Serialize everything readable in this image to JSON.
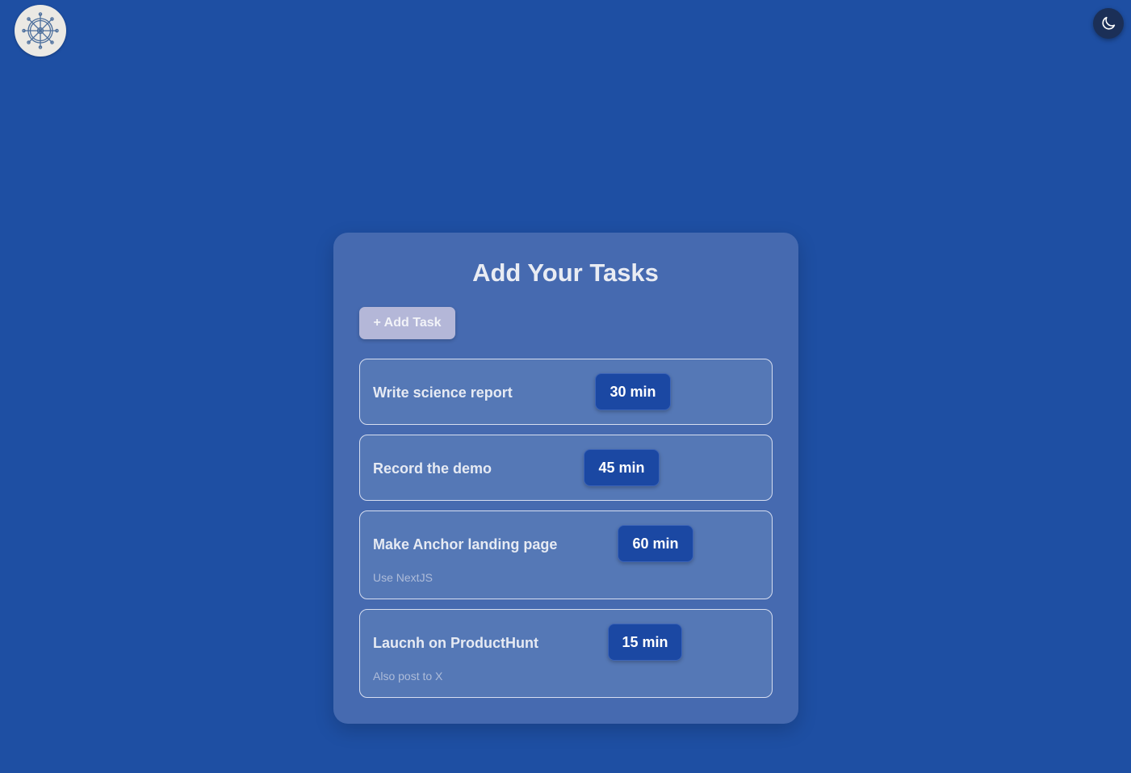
{
  "header": {
    "logo_icon": "ship-wheel-icon",
    "theme_toggle_icon": "moon-icon"
  },
  "main": {
    "title": "Add Your Tasks",
    "add_task_label": "+ Add Task",
    "tasks": [
      {
        "name": "Write science report",
        "duration": "30 min",
        "note": ""
      },
      {
        "name": "Record the demo",
        "duration": "45 min",
        "note": ""
      },
      {
        "name": "Make Anchor landing page",
        "duration": "60 min",
        "note": "Use NextJS"
      },
      {
        "name": "Laucnh on ProductHunt",
        "duration": "15 min",
        "note": "Also post to X"
      }
    ]
  },
  "colors": {
    "background": "#1e4fa3",
    "card": "#466ab0",
    "task_card": "#5578b6",
    "duration_badge": "#1b48a3",
    "add_button": "#b4b7d8"
  }
}
